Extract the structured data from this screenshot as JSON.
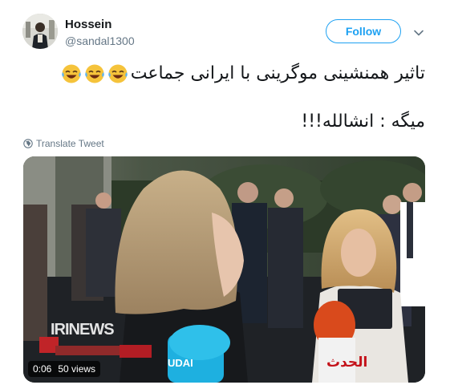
{
  "author": {
    "display_name": "Hossein",
    "handle": "@sandal1300",
    "avatar_icon": "profile-photo-avatar"
  },
  "follow_button": {
    "label": "Follow",
    "color": "#1da1f2"
  },
  "menu": {
    "icon": "chevron-down-icon"
  },
  "tweet": {
    "line1": "تاثیر همنشینی موگرینی با ایرانی جماعت",
    "line1_emoji": [
      "face-with-tears-of-joy",
      "face-with-tears-of-joy",
      "face-with-tears-of-joy"
    ],
    "line2": "میگه : انشالله!!!"
  },
  "translate": {
    "label": "Translate Tweet",
    "icon": "globe-icon"
  },
  "media": {
    "watermark": "IRINEWS",
    "duration": "0:06",
    "views": "50 views",
    "mic_label": "الحدث"
  },
  "colors": {
    "text_primary": "#14171a",
    "text_secondary": "#657786",
    "accent": "#1da1f2"
  }
}
